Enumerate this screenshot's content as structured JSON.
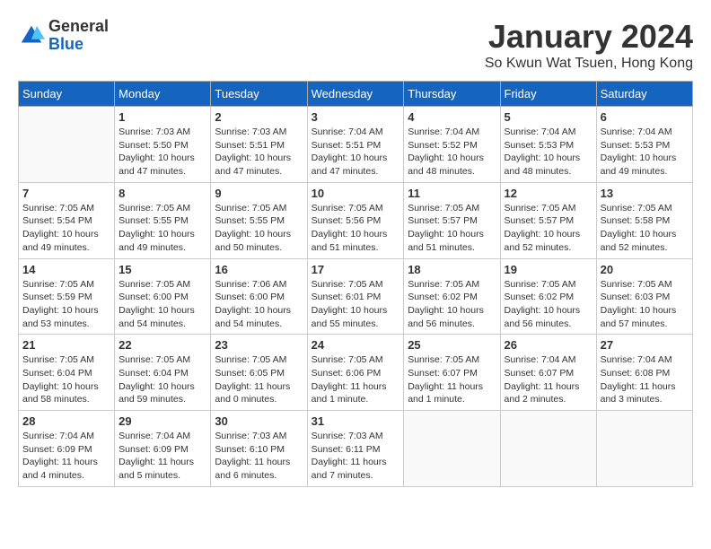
{
  "logo": {
    "general": "General",
    "blue": "Blue"
  },
  "title": "January 2024",
  "location": "So Kwun Wat Tsuen, Hong Kong",
  "weekdays": [
    "Sunday",
    "Monday",
    "Tuesday",
    "Wednesday",
    "Thursday",
    "Friday",
    "Saturday"
  ],
  "weeks": [
    [
      {
        "day": "",
        "info": ""
      },
      {
        "day": "1",
        "info": "Sunrise: 7:03 AM\nSunset: 5:50 PM\nDaylight: 10 hours\nand 47 minutes."
      },
      {
        "day": "2",
        "info": "Sunrise: 7:03 AM\nSunset: 5:51 PM\nDaylight: 10 hours\nand 47 minutes."
      },
      {
        "day": "3",
        "info": "Sunrise: 7:04 AM\nSunset: 5:51 PM\nDaylight: 10 hours\nand 47 minutes."
      },
      {
        "day": "4",
        "info": "Sunrise: 7:04 AM\nSunset: 5:52 PM\nDaylight: 10 hours\nand 48 minutes."
      },
      {
        "day": "5",
        "info": "Sunrise: 7:04 AM\nSunset: 5:53 PM\nDaylight: 10 hours\nand 48 minutes."
      },
      {
        "day": "6",
        "info": "Sunrise: 7:04 AM\nSunset: 5:53 PM\nDaylight: 10 hours\nand 49 minutes."
      }
    ],
    [
      {
        "day": "7",
        "info": "Sunrise: 7:05 AM\nSunset: 5:54 PM\nDaylight: 10 hours\nand 49 minutes."
      },
      {
        "day": "8",
        "info": "Sunrise: 7:05 AM\nSunset: 5:55 PM\nDaylight: 10 hours\nand 49 minutes."
      },
      {
        "day": "9",
        "info": "Sunrise: 7:05 AM\nSunset: 5:55 PM\nDaylight: 10 hours\nand 50 minutes."
      },
      {
        "day": "10",
        "info": "Sunrise: 7:05 AM\nSunset: 5:56 PM\nDaylight: 10 hours\nand 51 minutes."
      },
      {
        "day": "11",
        "info": "Sunrise: 7:05 AM\nSunset: 5:57 PM\nDaylight: 10 hours\nand 51 minutes."
      },
      {
        "day": "12",
        "info": "Sunrise: 7:05 AM\nSunset: 5:57 PM\nDaylight: 10 hours\nand 52 minutes."
      },
      {
        "day": "13",
        "info": "Sunrise: 7:05 AM\nSunset: 5:58 PM\nDaylight: 10 hours\nand 52 minutes."
      }
    ],
    [
      {
        "day": "14",
        "info": "Sunrise: 7:05 AM\nSunset: 5:59 PM\nDaylight: 10 hours\nand 53 minutes."
      },
      {
        "day": "15",
        "info": "Sunrise: 7:05 AM\nSunset: 6:00 PM\nDaylight: 10 hours\nand 54 minutes."
      },
      {
        "day": "16",
        "info": "Sunrise: 7:06 AM\nSunset: 6:00 PM\nDaylight: 10 hours\nand 54 minutes."
      },
      {
        "day": "17",
        "info": "Sunrise: 7:05 AM\nSunset: 6:01 PM\nDaylight: 10 hours\nand 55 minutes."
      },
      {
        "day": "18",
        "info": "Sunrise: 7:05 AM\nSunset: 6:02 PM\nDaylight: 10 hours\nand 56 minutes."
      },
      {
        "day": "19",
        "info": "Sunrise: 7:05 AM\nSunset: 6:02 PM\nDaylight: 10 hours\nand 56 minutes."
      },
      {
        "day": "20",
        "info": "Sunrise: 7:05 AM\nSunset: 6:03 PM\nDaylight: 10 hours\nand 57 minutes."
      }
    ],
    [
      {
        "day": "21",
        "info": "Sunrise: 7:05 AM\nSunset: 6:04 PM\nDaylight: 10 hours\nand 58 minutes."
      },
      {
        "day": "22",
        "info": "Sunrise: 7:05 AM\nSunset: 6:04 PM\nDaylight: 10 hours\nand 59 minutes."
      },
      {
        "day": "23",
        "info": "Sunrise: 7:05 AM\nSunset: 6:05 PM\nDaylight: 11 hours\nand 0 minutes."
      },
      {
        "day": "24",
        "info": "Sunrise: 7:05 AM\nSunset: 6:06 PM\nDaylight: 11 hours\nand 1 minute."
      },
      {
        "day": "25",
        "info": "Sunrise: 7:05 AM\nSunset: 6:07 PM\nDaylight: 11 hours\nand 1 minute."
      },
      {
        "day": "26",
        "info": "Sunrise: 7:04 AM\nSunset: 6:07 PM\nDaylight: 11 hours\nand 2 minutes."
      },
      {
        "day": "27",
        "info": "Sunrise: 7:04 AM\nSunset: 6:08 PM\nDaylight: 11 hours\nand 3 minutes."
      }
    ],
    [
      {
        "day": "28",
        "info": "Sunrise: 7:04 AM\nSunset: 6:09 PM\nDaylight: 11 hours\nand 4 minutes."
      },
      {
        "day": "29",
        "info": "Sunrise: 7:04 AM\nSunset: 6:09 PM\nDaylight: 11 hours\nand 5 minutes."
      },
      {
        "day": "30",
        "info": "Sunrise: 7:03 AM\nSunset: 6:10 PM\nDaylight: 11 hours\nand 6 minutes."
      },
      {
        "day": "31",
        "info": "Sunrise: 7:03 AM\nSunset: 6:11 PM\nDaylight: 11 hours\nand 7 minutes."
      },
      {
        "day": "",
        "info": ""
      },
      {
        "day": "",
        "info": ""
      },
      {
        "day": "",
        "info": ""
      }
    ]
  ]
}
